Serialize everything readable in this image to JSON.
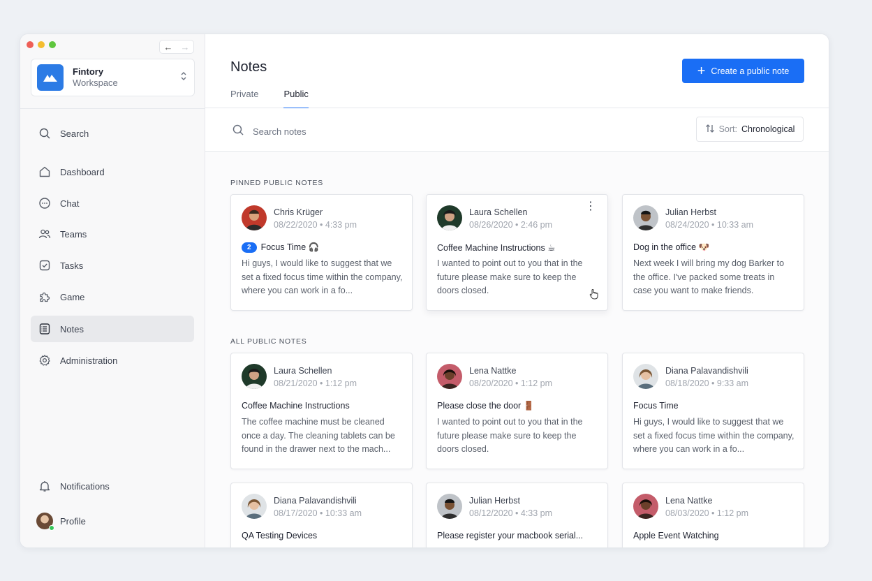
{
  "workspace": {
    "name": "Fintory",
    "subtitle": "Workspace"
  },
  "sidebar": {
    "items": [
      {
        "label": "Search",
        "icon": "search-icon"
      },
      {
        "label": "Dashboard",
        "icon": "home-icon"
      },
      {
        "label": "Chat",
        "icon": "chat-icon"
      },
      {
        "label": "Teams",
        "icon": "users-icon"
      },
      {
        "label": "Tasks",
        "icon": "check-square-icon"
      },
      {
        "label": "Game",
        "icon": "puzzle-icon"
      },
      {
        "label": "Notes",
        "icon": "notes-icon",
        "active": true
      },
      {
        "label": "Administration",
        "icon": "gear-icon"
      }
    ],
    "bottom": [
      {
        "label": "Notifications",
        "icon": "bell-icon"
      },
      {
        "label": "Profile",
        "icon": "avatar"
      }
    ]
  },
  "header": {
    "title": "Notes",
    "tabs": [
      {
        "label": "Private"
      },
      {
        "label": "Public",
        "active": true
      }
    ],
    "create_label": "Create a public note"
  },
  "search": {
    "placeholder": "Search notes",
    "sort_label": "Sort:",
    "sort_value": "Chronological"
  },
  "sections": {
    "pinned": "PINNED PUBLIC NOTES",
    "all": "ALL PUBLIC NOTES"
  },
  "pinned_notes": [
    {
      "author": "Chris Krüger",
      "date": "08/22/2020 • 4:33 pm",
      "badge": "2",
      "title": "Focus Time 🎧",
      "body": "Hi guys, I would like to suggest that we set a fixed focus time within the company, where you can work in a fo..."
    },
    {
      "author": "Laura Schellen",
      "date": "08/26/2020 • 2:46 pm",
      "title": "Coffee Machine Instructions ☕",
      "body": "I wanted to point out to you that in the future please make sure to keep the doors closed."
    },
    {
      "author": "Julian Herbst",
      "date": "08/24/2020 • 10:33 am",
      "title": "Dog in the office 🐶",
      "body": "Next week I will bring my dog Barker to the office. I've packed some treats in case you want to make friends."
    }
  ],
  "all_notes": [
    {
      "author": "Laura Schellen",
      "date": "08/21/2020 • 1:12 pm",
      "title": "Coffee Machine Instructions",
      "body": "The coffee machine must be cleaned once a day. The cleaning tablets can be found in the drawer next to the mach..."
    },
    {
      "author": "Lena Nattke",
      "date": "08/20/2020 • 1:12 pm",
      "title": "Please close the door 🚪",
      "body": "I wanted to point out to you that in the future please make sure to keep the doors closed."
    },
    {
      "author": "Diana Palavandishvili",
      "date": "08/18/2020 • 9:33 am",
      "title": "Focus Time",
      "body": "Hi guys, I would like to suggest that we set a fixed focus time within the company, where you can work in a fo..."
    },
    {
      "author": "Diana Palavandishvili",
      "date": "08/17/2020 • 10:33 am",
      "title": "QA Testing Devices",
      "body": ""
    },
    {
      "author": "Julian Herbst",
      "date": "08/12/2020 • 4:33 pm",
      "title": "Please register your macbook serial...",
      "body": ""
    },
    {
      "author": "Lena Nattke",
      "date": "08/03/2020 • 1:12 pm",
      "title": "Apple Event Watching",
      "body": ""
    }
  ],
  "colors": {
    "accent": "#1a6ef5",
    "brand": "#2c7be5"
  }
}
